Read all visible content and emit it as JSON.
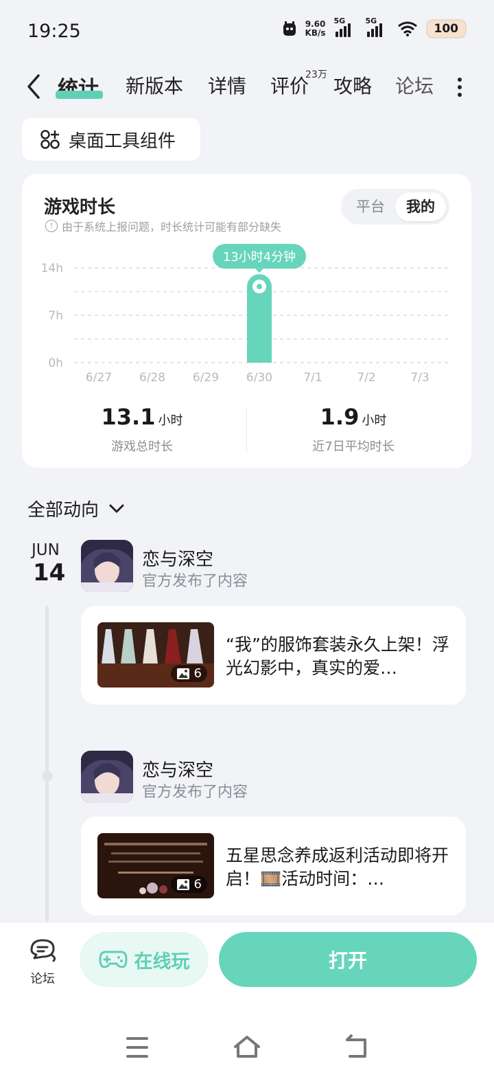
{
  "status_bar": {
    "time": "19:25",
    "speed_value": "9.60",
    "speed_unit": "KB/s",
    "net1": "5G",
    "net2": "5G",
    "battery": "100"
  },
  "tabs": [
    {
      "label": "统计",
      "active": true
    },
    {
      "label": "新版本"
    },
    {
      "label": "详情"
    },
    {
      "label": "评价",
      "badge": "23万"
    },
    {
      "label": "攻略"
    },
    {
      "label": "论坛"
    }
  ],
  "widget_button": {
    "label": "桌面工具组件"
  },
  "stats": {
    "title": "游戏时长",
    "note": "由于系统上报问题，时长统计可能有部分缺失",
    "segment": {
      "platform": "平台",
      "mine": "我的"
    },
    "total": {
      "value": "13.1",
      "unit": "小时",
      "label": "游戏总时长"
    },
    "average": {
      "value": "1.9",
      "unit": "小时",
      "label": "近7日平均时长"
    }
  },
  "chart_data": {
    "type": "bar",
    "categories": [
      "6/27",
      "6/28",
      "6/29",
      "6/30",
      "7/1",
      "7/2",
      "7/3"
    ],
    "values": [
      0,
      0,
      0,
      13.07,
      0,
      0,
      0
    ],
    "yticks": [
      "0h",
      "7h",
      "14h"
    ],
    "ylim": [
      0,
      14
    ],
    "highlight": {
      "index": 3,
      "label": "13小时4分钟"
    },
    "bar_color": "#66d5bb"
  },
  "feed": {
    "filter_label": "全部动向",
    "date": {
      "month": "JUN",
      "day": "14"
    },
    "posts": [
      {
        "author": "恋与深空",
        "subtitle": "官方发布了内容",
        "text": "“我”的服饰套装永久上架！浮光幻影中，真实的爱…",
        "image_count": "6"
      },
      {
        "author": "恋与深空",
        "subtitle": "官方发布了内容",
        "text": "五星思念养成返利活动即将开启！🎞️活动时间：…",
        "image_count": "6"
      }
    ]
  },
  "bottom": {
    "forum_label": "论坛",
    "cloud_label": "在线玩",
    "open_label": "打开"
  },
  "colors": {
    "accent": "#66d5bb",
    "background": "#f2f3f7"
  }
}
